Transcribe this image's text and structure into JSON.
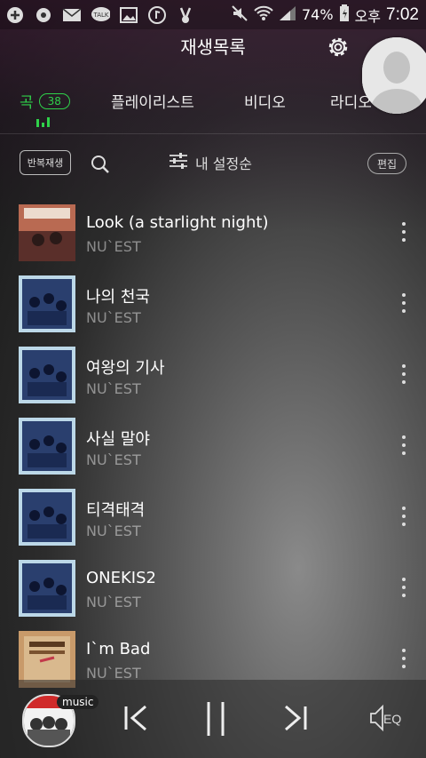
{
  "statusbar": {
    "battery": "74%",
    "ampm": "오후",
    "time": "7:02",
    "icons": [
      "plus-icon",
      "chat-icon",
      "mail-icon",
      "talk-icon",
      "image-icon",
      "music-note-icon",
      "victory-icon",
      "mute-icon",
      "wifi-icon",
      "signal-icon",
      "battery-icon"
    ]
  },
  "header": {
    "title": "재생목록",
    "settings_icon": "gear-icon",
    "avatar_icon": "profile-icon"
  },
  "tabs": {
    "song_label": "곡",
    "song_count": "38",
    "playlist_label": "플레이리스트",
    "video_label": "비디오",
    "radio_label": "라디오"
  },
  "toolbar": {
    "repeat_label": "반복재생",
    "sort_label": "내 설정순",
    "edit_label": "편집"
  },
  "tracks": [
    {
      "title": "Look (a starlight night)",
      "artist": "NU`EST",
      "cover": "look-cover"
    },
    {
      "title": "나의 천국",
      "artist": "NU`EST",
      "cover": "blue-cover"
    },
    {
      "title": "여왕의 기사",
      "artist": "NU`EST",
      "cover": "blue-cover"
    },
    {
      "title": "사실 말야",
      "artist": "NU`EST",
      "cover": "blue-cover"
    },
    {
      "title": "티격태격",
      "artist": "NU`EST",
      "cover": "blue-cover"
    },
    {
      "title": "ONEKIS2",
      "artist": "NU`EST",
      "cover": "blue-cover"
    },
    {
      "title": "I`m Bad",
      "artist": "NU`EST",
      "cover": "special-cover"
    }
  ],
  "player": {
    "tag": "music",
    "eq_label": "EQ"
  },
  "colors": {
    "accent_green": "#2fd14a"
  }
}
